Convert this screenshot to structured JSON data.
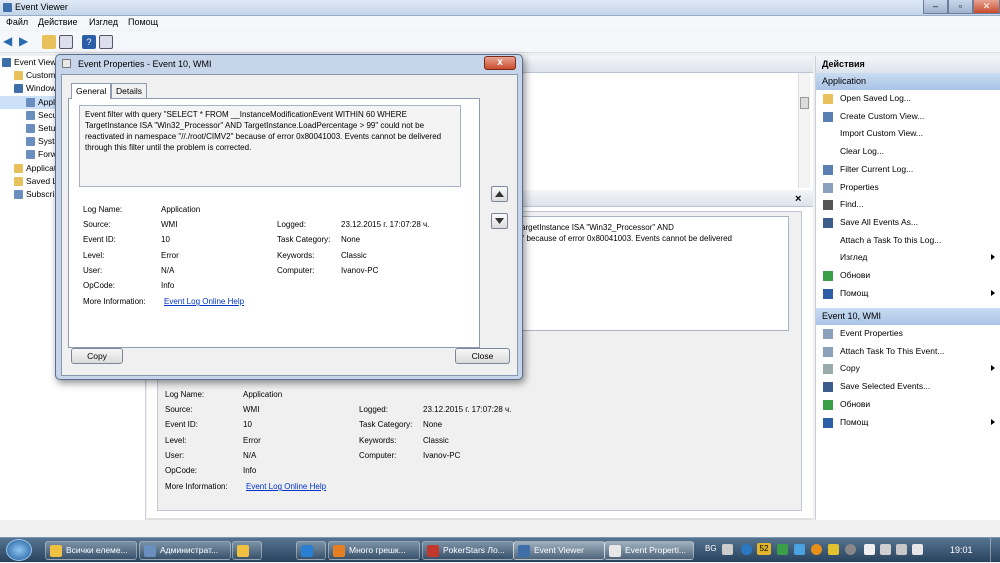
{
  "window": {
    "title": "Event Viewer"
  },
  "menu": [
    "Файл",
    "Действие",
    "Изглед",
    "Помощ"
  ],
  "tree": [
    {
      "label": "Event Viewer",
      "level": 0
    },
    {
      "label": "Custom",
      "level": 1
    },
    {
      "label": "Window",
      "level": 1
    },
    {
      "label": "Applic",
      "level": 2,
      "selected": true
    },
    {
      "label": "Secu",
      "level": 2
    },
    {
      "label": "Setup",
      "level": 2
    },
    {
      "label": "Syste",
      "level": 2
    },
    {
      "label": "Forw",
      "level": 2
    },
    {
      "label": "Applicat",
      "level": 1
    },
    {
      "label": "Saved Lo",
      "level": 1
    },
    {
      "label": "Subscrip",
      "level": 1
    }
  ],
  "dialog": {
    "title": "Event Properties - Event 10, WMI",
    "tabs": [
      "General",
      "Details"
    ],
    "description": "Event filter with query \"SELECT * FROM __InstanceModificationEvent WITHIN 60 WHERE TargetInstance ISA \"Win32_Processor\" AND TargetInstance.LoadPercentage > 99\" could not be reactivated in namespace \"//./root/CIMV2\" because of error 0x80041003. Events cannot be delivered through this filter until the problem is corrected.",
    "fields": {
      "log_name_label": "Log Name:",
      "log_name": "Application",
      "source_label": "Source:",
      "source": "WMI",
      "logged_label": "Logged:",
      "logged": "23.12.2015 г. 17:07:28 ч.",
      "event_id_label": "Event ID:",
      "event_id": "10",
      "task_category_label": "Task Category:",
      "task_category": "None",
      "level_label": "Level:",
      "level": "Error",
      "keywords_label": "Keywords:",
      "keywords": "Classic",
      "user_label": "User:",
      "user": "N/A",
      "computer_label": "Computer:",
      "computer": "Ivanov-PC",
      "opcode_label": "OpCode:",
      "opcode": "Info",
      "more_info_label": "More Information:",
      "more_info_link": "Event Log Online Help"
    },
    "copy_button": "Copy",
    "close_button": "Close",
    "close_x": "x"
  },
  "preview": {
    "text_line1": "TargetInstance ISA \"Win32_Processor\" AND",
    "text_line2": "2\" because of error 0x80041003. Events cannot be delivered",
    "close_x": "×"
  },
  "actions": {
    "header": "Действия",
    "section1": "Application",
    "items1": [
      {
        "label": "Open Saved Log...",
        "icon": "folder-icon"
      },
      {
        "label": "Create Custom View...",
        "icon": "filter-icon"
      },
      {
        "label": "Import Custom View...",
        "icon": ""
      },
      {
        "label": "Clear Log...",
        "icon": ""
      },
      {
        "label": "Filter Current Log...",
        "icon": "filter-icon"
      },
      {
        "label": "Properties",
        "icon": "properties-icon"
      },
      {
        "label": "Find...",
        "icon": "find-icon"
      },
      {
        "label": "Save All Events As...",
        "icon": "save-icon"
      },
      {
        "label": "Attach a Task To this Log...",
        "icon": ""
      },
      {
        "label": "Изглед",
        "icon": "",
        "submenu": true
      },
      {
        "label": "Обнови",
        "icon": "refresh-icon"
      },
      {
        "label": "Помощ",
        "icon": "help-icon",
        "submenu": true
      }
    ],
    "section2": "Event 10, WMI",
    "items2": [
      {
        "label": "Event Properties",
        "icon": "properties-icon"
      },
      {
        "label": "Attach Task To This Event...",
        "icon": "task-icon"
      },
      {
        "label": "Copy",
        "icon": "copy-icon",
        "submenu": true
      },
      {
        "label": "Save Selected Events...",
        "icon": "save-icon"
      },
      {
        "label": "Обнови",
        "icon": "refresh-icon"
      },
      {
        "label": "Помощ",
        "icon": "help-icon",
        "submenu": true
      }
    ]
  },
  "taskbar": {
    "tasks": [
      "Всички елеме...",
      "Администрат...",
      "",
      "",
      "Много грешк...",
      "PokerStars Ло...",
      "Event Viewer",
      "Event Properti..."
    ],
    "lang": "BG",
    "tray_number": "52",
    "clock": "19:01"
  },
  "colors": {
    "accent": "#c84b2d",
    "selection": "#cce0f7",
    "taskbar": "#27425e"
  }
}
